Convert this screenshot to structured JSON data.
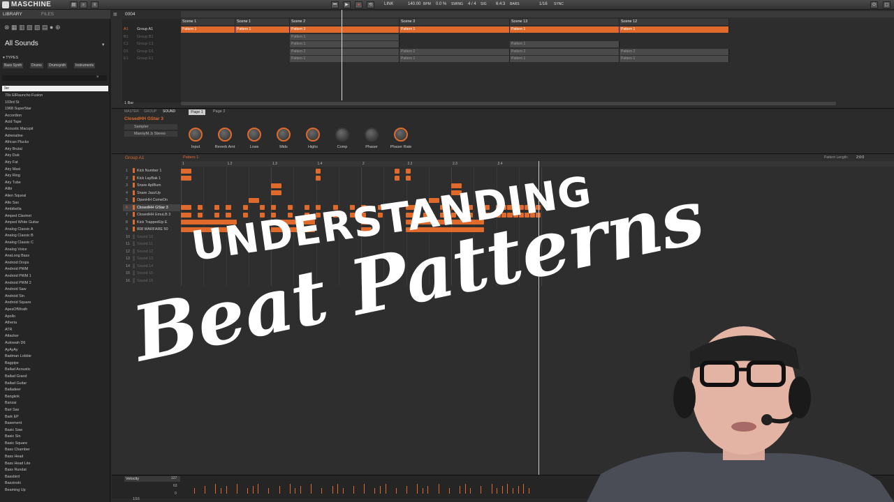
{
  "app": {
    "name": "MASCHINE"
  },
  "transport": {
    "link": "LINK",
    "tempo": "140.00",
    "tempo_unit": "BPM",
    "swing": "0.0 %",
    "swing_label": "SWING",
    "sig": "4 / 4",
    "sig_label": "SIG",
    "bars": "6:4:3",
    "bars_label": "BARS",
    "quant": "1/16",
    "sync": "SYNC"
  },
  "library": {
    "tabs": [
      "LIBRARY",
      "FILES"
    ],
    "title": "All Sounds",
    "types_label": "▾ TYPES",
    "chips": [
      "Bass Synth",
      "Drums",
      "Drumsynth",
      "Instruments"
    ],
    "selected": "9er",
    "items": [
      "70s ElRauncho Fusion",
      "103rd St",
      "1968 SuperStar",
      "Accordion",
      "Acid Tape",
      "Acoustic Macspit",
      "Adrenaline",
      "African Plucks",
      "Airy Brutal",
      "Airy Dub",
      "Airy Fat",
      "Airy Maxi",
      "Airy Ring",
      "Airy Tube",
      "Alibi",
      "Alien Squeal",
      "Alto Sax",
      "Ambibella",
      "Amped Clavinet",
      "Amped White Guitar",
      "Analog Classic A",
      "Analog Classic B",
      "Analog Classic C",
      "Analog Voice",
      "AnaLoog Bass",
      "Android Drops",
      "Android PWM",
      "Android PWM 1",
      "Android PWM 2",
      "Android Saw",
      "Android Sin",
      "Android Square",
      "ApesOfWrath",
      "Apollo",
      "Atheria",
      "ATR",
      "Attacker",
      "Autowah D6",
      "AyAyAy",
      "Badman Lobbie",
      "Bagpipe",
      "Ballad Acoustic",
      "Ballad Grand",
      "Ballad Guitar",
      "Balladeer",
      "Bangkok",
      "Banzai",
      "Bari Sax",
      "Bark EP",
      "Basement",
      "Basic Saw",
      "Basic Sin",
      "Basic Square",
      "Bass Chamber",
      "Bass Head",
      "Bass Head Lite",
      "Bass Rundat",
      "Bassbird",
      "Bazzinski",
      "Beaming Up"
    ]
  },
  "arranger": {
    "position": "0004",
    "bar_label": "1 Bar",
    "scenes": [
      "Scene 1",
      "Scene 1",
      "Scene 2",
      "Scene 3",
      "Scene 13",
      "Scene 12"
    ],
    "groups": [
      {
        "id": "A1",
        "name": "Group A1"
      },
      {
        "id": "B1",
        "name": "Group B1"
      },
      {
        "id": "C1",
        "name": "Group C1"
      },
      {
        "id": "D1",
        "name": "Group D1"
      },
      {
        "id": "E1",
        "name": "Group E1"
      }
    ],
    "pattern_name": "Pattern 1",
    "pattern2": "Pattern 2",
    "pattern3": "Pattern 3"
  },
  "control": {
    "tabs": [
      "MASTER",
      "GROUP",
      "SOUND"
    ],
    "sound_name": "ClosedHH GStar 3",
    "plugin": "Sampler",
    "preset": "MannyM..b Stereo",
    "pages": [
      "Page 1",
      "Page 2"
    ],
    "knobs": [
      "Input",
      "Reverb Amt",
      "Lows",
      "Mids",
      "Highs",
      "Comp",
      "Phaser",
      "Phaser Rate"
    ]
  },
  "pattern": {
    "group": "Group A1",
    "pattern": "Pattern 1",
    "length_label": "Pattern Length:",
    "length": "2:0:0",
    "ruler": [
      "1",
      "1.2",
      "1.3",
      "1.4",
      "2",
      "2.2",
      "2.3",
      "2.4"
    ],
    "sounds": [
      "Kick Number 1",
      "Kick LayBak 1",
      "Snare AplBum",
      "Snare JazzUp",
      "OpenHH ComeOn",
      "ClosedHH GStar 3",
      "ClosedHH EmuLB 3",
      "Kick TrappedUp E",
      "808 WARFARE 50",
      "Sound 10",
      "Sound 11",
      "Sound 12",
      "Sound 13",
      "Sound 14",
      "Sound 15",
      "Sound 16"
    ]
  },
  "velocity": {
    "label": "Velocity",
    "max": "127",
    "mid": "63",
    "min": "0",
    "quant": "1/16"
  },
  "overlay": {
    "line1": "UNDERSTANDING",
    "line2": "Beat Patterns"
  },
  "colors": {
    "accent": "#e06a2c"
  }
}
